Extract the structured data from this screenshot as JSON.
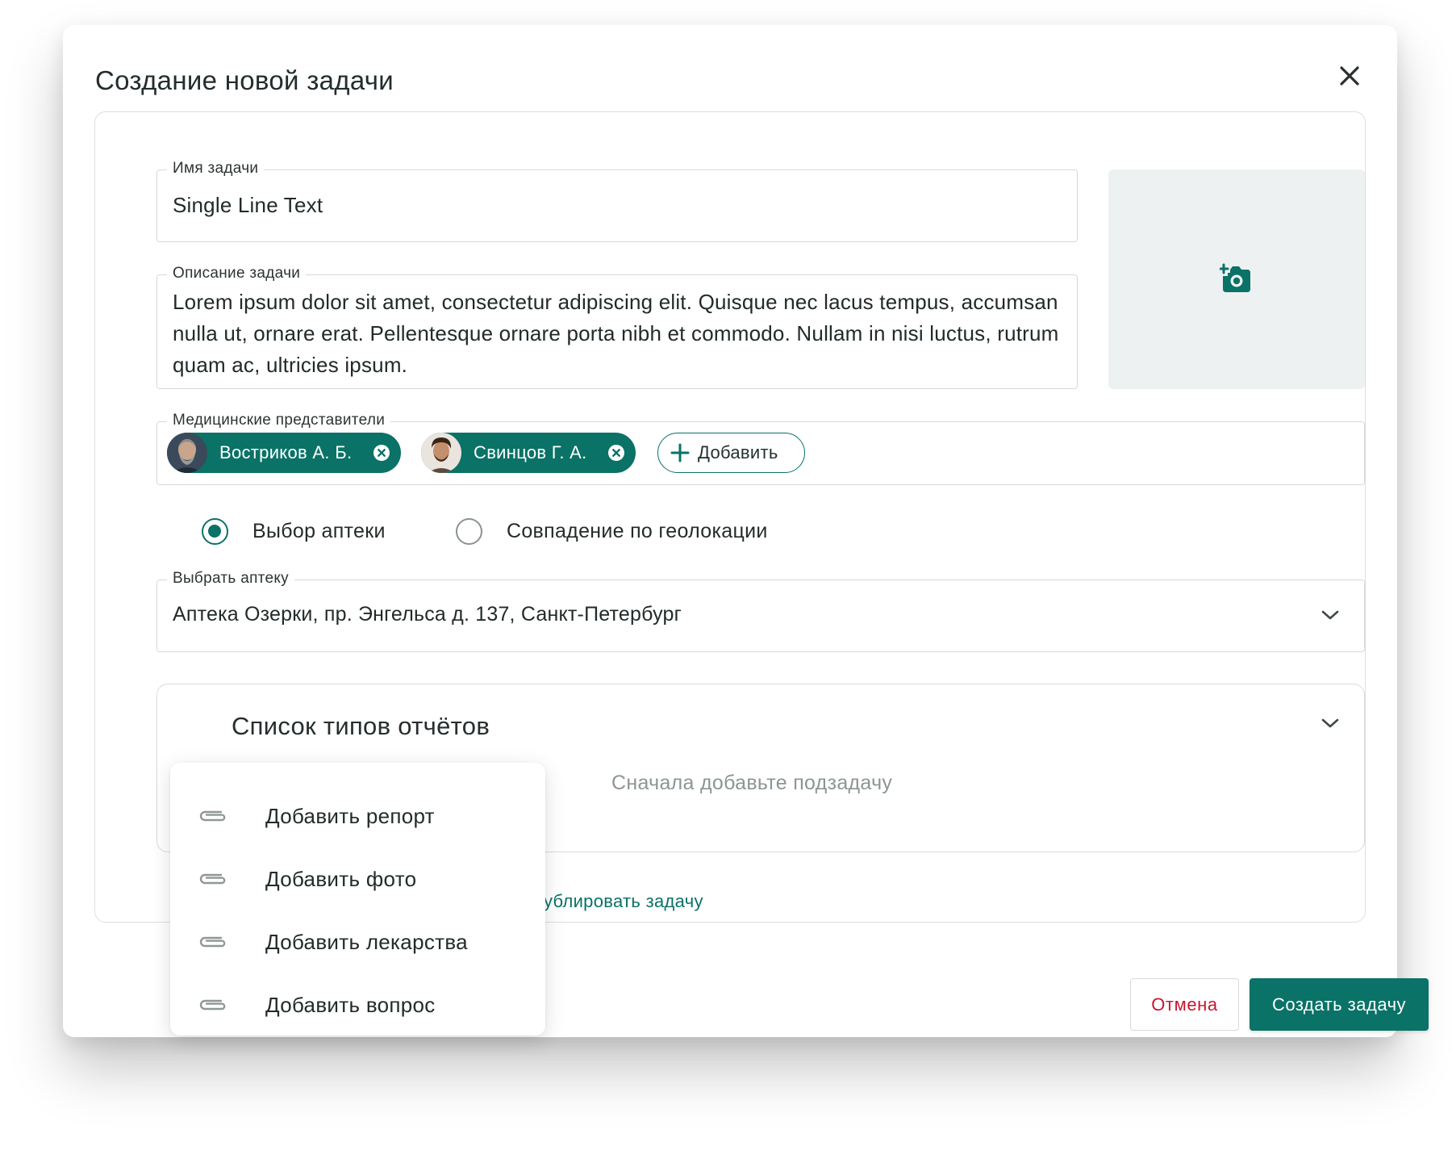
{
  "dialog": {
    "title": "Создание новой задачи"
  },
  "task_name": {
    "label": "Имя задачи",
    "value": "Single Line Text"
  },
  "task_description": {
    "label": "Описание задачи",
    "value": "Lorem ipsum dolor sit amet, consectetur adipiscing elit. Quisque nec lacus tempus, accumsan nulla ut, ornare erat. Pellentesque ornare porta nibh et commodo. Nullam in nisi luctus, rutrum quam ac, ultricies ipsum."
  },
  "photo_upload": {
    "icon": "add-photo-icon"
  },
  "medical_reps": {
    "label": "Медицинские представители",
    "chips": [
      {
        "name": "Востриков А. Б."
      },
      {
        "name": "Свинцов Г. А."
      }
    ],
    "add_label": "Добавить"
  },
  "pharmacy_mode": {
    "options": [
      {
        "label": "Выбор аптеки",
        "selected": true
      },
      {
        "label": "Совпадение по геолокации",
        "selected": false
      }
    ]
  },
  "pharmacy_select": {
    "label": "Выбрать аптеку",
    "value": "Аптека Озерки, пр. Энгельса д. 137, Санкт-Петербург"
  },
  "reports_section": {
    "title": "Список типов отчётов",
    "empty_text": "Сначала добавьте подзадачу"
  },
  "duplicate_link": "ублировать задачу",
  "add_menu": {
    "items": [
      {
        "label": "Добавить репорт",
        "icon": "paperclip-icon"
      },
      {
        "label": "Добавить фото",
        "icon": "paperclip-icon"
      },
      {
        "label": "Добавить лекарства",
        "icon": "paperclip-icon"
      },
      {
        "label": "Добавить вопрос",
        "icon": "paperclip-icon"
      }
    ]
  },
  "footer": {
    "cancel_label": "Отмена",
    "create_label": "Создать задачу"
  },
  "colors": {
    "accent": "#0a7266",
    "danger": "#c8152f",
    "border": "#d6d9d9",
    "photo_bg": "#eef1f1",
    "placeholder_text": "#8d9595"
  }
}
